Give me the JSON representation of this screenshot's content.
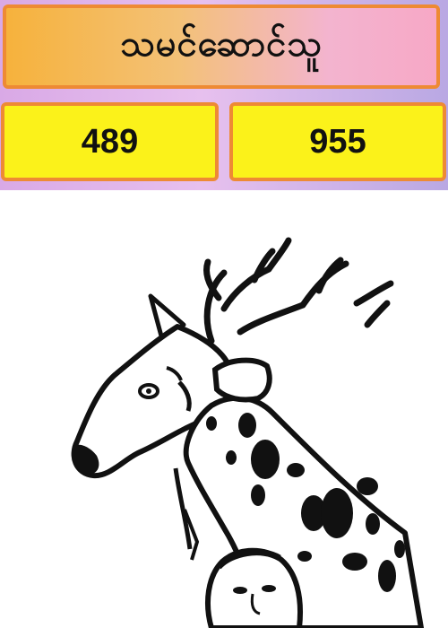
{
  "header": {
    "title": "သမင်ဆောင်သူ"
  },
  "numbers": {
    "left": "489",
    "right": "955"
  },
  "picture": {
    "subject": "deer-with-person-illustration"
  },
  "colors": {
    "title_gradient_start": "#f6b23c",
    "title_gradient_end": "#f7a8c6",
    "box_border": "#ee8a34",
    "number_box_fill": "#fbf21a",
    "band_background": "#d9a9e6"
  }
}
